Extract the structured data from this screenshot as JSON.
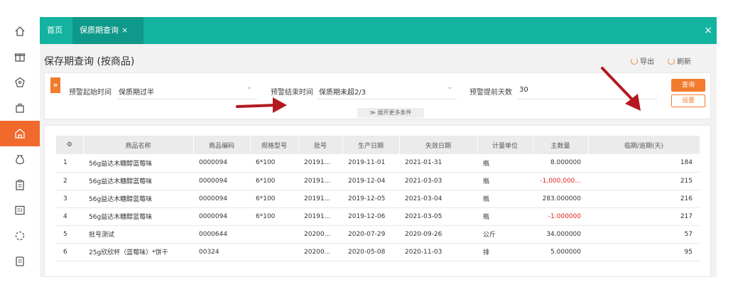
{
  "tabs": {
    "home": "首页",
    "active": "保质期查询",
    "close_tab": "×",
    "close_all": "×"
  },
  "sidebar": {
    "items": [
      {
        "icon": "home-icon"
      },
      {
        "icon": "gift-icon"
      },
      {
        "icon": "tag-icon"
      },
      {
        "icon": "bag-icon"
      },
      {
        "icon": "store-icon",
        "active": true
      },
      {
        "icon": "money-bag-icon"
      },
      {
        "icon": "clipboard-icon"
      },
      {
        "icon": "report-icon"
      },
      {
        "icon": "loading-icon"
      },
      {
        "icon": "document-icon"
      }
    ]
  },
  "page": {
    "title": "保存期查询 (按商品)",
    "export_label": "导出",
    "refresh_label": "刷新"
  },
  "filter": {
    "expand_label": "»",
    "start_label": "预警起始时间",
    "start_value": "保质期过半",
    "end_label": "预警结束时间",
    "end_value": "保质期未超2/3",
    "days_label": "预警提前天数",
    "days_value": "30",
    "more_label": "≫ 展开更多条件",
    "query_label": "查询",
    "settings_label": "设置"
  },
  "table": {
    "settings_icon": "⚙",
    "headers": [
      "商品名称",
      "商品编码",
      "规格型号",
      "批号",
      "生产日期",
      "失效日期",
      "计量单位",
      "主数量",
      "临期/逾期(天)"
    ],
    "rows": [
      {
        "idx": "1",
        "name": "56g益达木糖醇蓝莓味",
        "code": "0000094",
        "spec": "6*100",
        "batch": "20191...",
        "prod": "2019-11-01",
        "exp": "2021-01-31",
        "unit": "瓶",
        "qty": "8.000000",
        "days": "184",
        "neg": false
      },
      {
        "idx": "2",
        "name": "56g益达木糖醇蓝莓味",
        "code": "0000094",
        "spec": "6*100",
        "batch": "20191...",
        "prod": "2019-12-04",
        "exp": "2021-03-03",
        "unit": "瓶",
        "qty": "-1,000,000...",
        "days": "215",
        "neg": true
      },
      {
        "idx": "3",
        "name": "56g益达木糖醇蓝莓味",
        "code": "0000094",
        "spec": "6*100",
        "batch": "20191...",
        "prod": "2019-12-05",
        "exp": "2021-03-04",
        "unit": "瓶",
        "qty": "283.000000",
        "days": "216",
        "neg": false
      },
      {
        "idx": "4",
        "name": "56g益达木糖醇蓝莓味",
        "code": "0000094",
        "spec": "6*100",
        "batch": "20191...",
        "prod": "2019-12-06",
        "exp": "2021-03-05",
        "unit": "瓶",
        "qty": "-1.000000",
        "days": "217",
        "neg": true
      },
      {
        "idx": "5",
        "name": "批号测试",
        "code": "0000644",
        "spec": "",
        "batch": "20200...",
        "prod": "2020-07-29",
        "exp": "2020-09-26",
        "unit": "公斤",
        "qty": "34.000000",
        "days": "57",
        "neg": false
      },
      {
        "idx": "6",
        "name": "25g欣欣杯（蓝莓味）*饼干",
        "code": "00324",
        "spec": "",
        "batch": "20200...",
        "prod": "2020-05-08",
        "exp": "2020-11-03",
        "unit": "排",
        "qty": "5.000000",
        "days": "95",
        "neg": false
      }
    ]
  },
  "colors": {
    "teal": "#13b3a0",
    "orange": "#f27b2d",
    "negative": "#e02020",
    "arrow": "#b3191f"
  }
}
